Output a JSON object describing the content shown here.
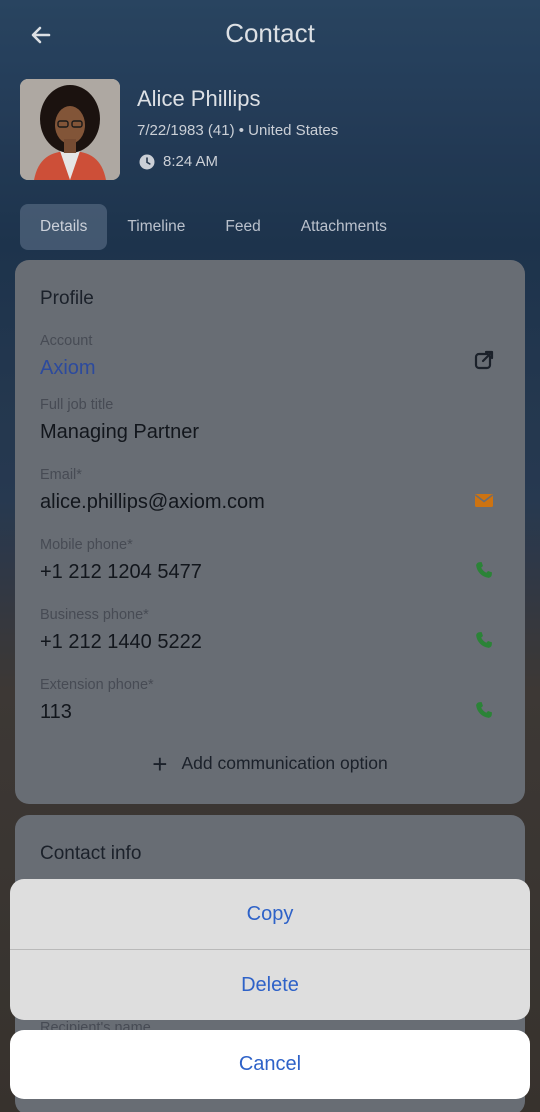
{
  "header": {
    "title": "Contact"
  },
  "contact": {
    "name": "Alice Phillips",
    "meta": "7/22/1983 (41) • United States",
    "time": "8:24 AM"
  },
  "tabs": [
    {
      "label": "Details",
      "active": true
    },
    {
      "label": "Timeline"
    },
    {
      "label": "Feed"
    },
    {
      "label": "Attachments"
    }
  ],
  "profile": {
    "title": "Profile",
    "account": {
      "label": "Account",
      "value": "Axiom"
    },
    "job_title": {
      "label": "Full job title",
      "value": "Managing Partner"
    },
    "email": {
      "label": "Email*",
      "value": "alice.phillips@axiom.com"
    },
    "mobile": {
      "label": "Mobile phone*",
      "value": "+1 212 1204 5477"
    },
    "business": {
      "label": "Business phone*",
      "value": "+1 212 1440 5222"
    },
    "extension": {
      "label": "Extension phone*",
      "value": "113"
    },
    "add_option": "Add communication option"
  },
  "contact_info": {
    "title": "Contact info",
    "partial_label": "Recipient's name"
  },
  "action_sheet": {
    "copy": "Copy",
    "delete": "Delete",
    "cancel": "Cancel"
  },
  "colors": {
    "accent_link": "#2f4fa6",
    "email_icon": "#d97a12",
    "phone_icon": "#2e8b3a",
    "sheet_text": "#2e62c8"
  }
}
